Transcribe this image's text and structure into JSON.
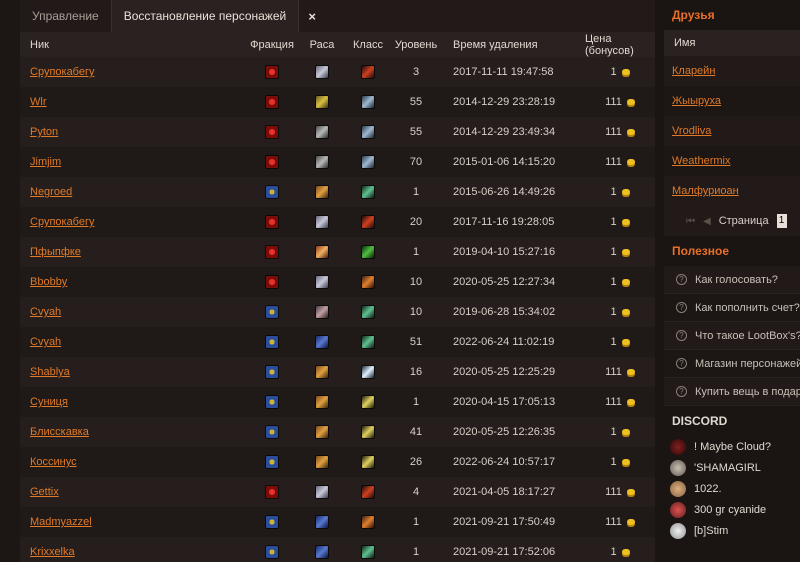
{
  "tabs": [
    {
      "label": "Управление"
    },
    {
      "label": "Восстановление персонажей"
    }
  ],
  "tab_close_icon": "×",
  "table": {
    "headers": {
      "name": "Ник",
      "faction": "Фракция",
      "race": "Раса",
      "class": "Класс",
      "level": "Уровень",
      "deleted": "Время удаления",
      "price": "Цена (бонусов)"
    },
    "rows": [
      {
        "name": "Срупокабегу",
        "faction": "horde",
        "race": "race-a",
        "class": "cls-a",
        "level": "3",
        "deleted": "2017-11-11 19:47:58",
        "price": "1"
      },
      {
        "name": "Wlr",
        "faction": "horde",
        "race": "race-b",
        "class": "cls-b",
        "level": "55",
        "deleted": "2014-12-29 23:28:19",
        "price": "111"
      },
      {
        "name": "Pyton",
        "faction": "horde",
        "race": "race-c",
        "class": "cls-b",
        "level": "55",
        "deleted": "2014-12-29 23:49:34",
        "price": "111"
      },
      {
        "name": "Jimjim",
        "faction": "horde",
        "race": "race-c",
        "class": "cls-b",
        "level": "70",
        "deleted": "2015-01-06 14:15:20",
        "price": "111"
      },
      {
        "name": "Negroed",
        "faction": "alliance",
        "race": "race-d",
        "class": "cls-c",
        "level": "1",
        "deleted": "2015-06-26 14:49:26",
        "price": "1"
      },
      {
        "name": "Срупокабегу",
        "faction": "horde",
        "race": "race-a",
        "class": "cls-a",
        "level": "20",
        "deleted": "2017-11-16 19:28:05",
        "price": "1"
      },
      {
        "name": "Пфыпфке",
        "faction": "horde",
        "race": "race-e",
        "class": "cls-g",
        "level": "1",
        "deleted": "2019-04-10 15:27:16",
        "price": "1"
      },
      {
        "name": "Bbobby",
        "faction": "horde",
        "race": "race-a",
        "class": "cls-d",
        "level": "10",
        "deleted": "2020-05-25 12:27:34",
        "price": "1"
      },
      {
        "name": "Cvyah",
        "faction": "alliance",
        "race": "race-g",
        "class": "cls-c",
        "level": "10",
        "deleted": "2019-06-28 15:34:02",
        "price": "1"
      },
      {
        "name": "Cvyah",
        "faction": "alliance",
        "race": "race-f",
        "class": "cls-c",
        "level": "51",
        "deleted": "2022-06-24 11:02:19",
        "price": "1"
      },
      {
        "name": "Shablya",
        "faction": "alliance",
        "race": "race-d",
        "class": "cls-f",
        "level": "16",
        "deleted": "2020-05-25 12:25:29",
        "price": "111"
      },
      {
        "name": "Суниця",
        "faction": "alliance",
        "race": "race-d",
        "class": "cls-e",
        "level": "1",
        "deleted": "2020-04-15 17:05:13",
        "price": "111"
      },
      {
        "name": "Блисскавка",
        "faction": "alliance",
        "race": "race-d",
        "class": "cls-e",
        "level": "41",
        "deleted": "2020-05-25 12:26:35",
        "price": "1"
      },
      {
        "name": "Коссинус",
        "faction": "alliance",
        "race": "race-d",
        "class": "cls-e",
        "level": "26",
        "deleted": "2022-06-24 10:57:17",
        "price": "1"
      },
      {
        "name": "Gettix",
        "faction": "horde",
        "race": "race-a",
        "class": "cls-a",
        "level": "4",
        "deleted": "2021-04-05 18:17:27",
        "price": "111"
      },
      {
        "name": "Madmyazzel",
        "faction": "alliance",
        "race": "race-f",
        "class": "cls-d",
        "level": "1",
        "deleted": "2021-09-21 17:50:49",
        "price": "111"
      },
      {
        "name": "Krixxelka",
        "faction": "alliance",
        "race": "race-f",
        "class": "cls-c",
        "level": "1",
        "deleted": "2021-09-21 17:52:06",
        "price": "1"
      }
    ]
  },
  "sidebar": {
    "friends_title": "Друзья",
    "friends_header": "Имя",
    "friends": [
      "Кларейн",
      "Жыыруха",
      "Vrodliva",
      "Weathermix",
      "Малфуриоан"
    ],
    "pager": {
      "first": "⏮",
      "prev": "◀",
      "label": "Страница",
      "page": "1"
    },
    "useful_title": "Полезное",
    "useful": [
      "Как голосовать?",
      "Как пополнить счет?",
      "Что такое LootBox's?",
      "Магазин персонажей",
      "Купить вещь в подарок"
    ],
    "discord_title": "DISCORD",
    "discord": [
      "! Maybe Cloud?",
      "'SHAMAGIRL",
      "1022.",
      "300 gr cyanide",
      "[b]Stim"
    ]
  },
  "colors": {
    "accent": "#e8702a",
    "link": "#e07a28",
    "coin": "#f0c020"
  }
}
